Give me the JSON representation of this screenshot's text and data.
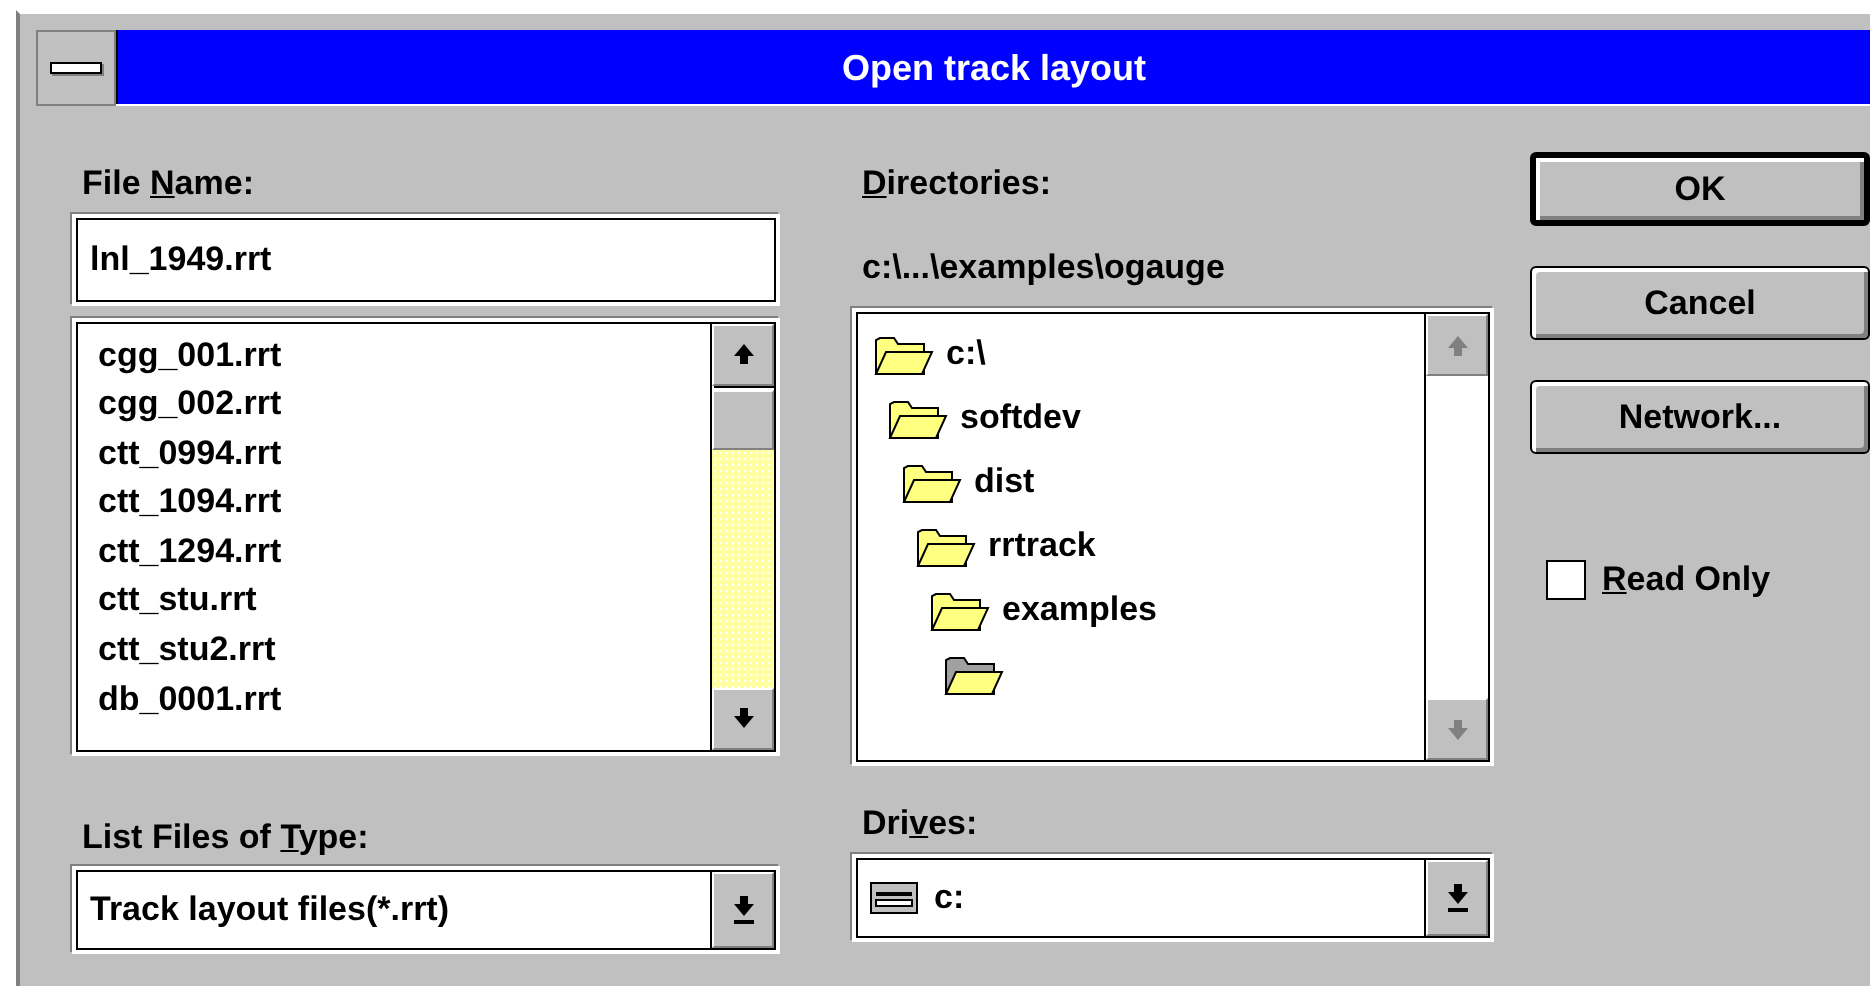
{
  "window": {
    "title": "Open track layout"
  },
  "file_name": {
    "label_start": "File ",
    "access_key": "N",
    "label_end": "ame:",
    "value": "lnl_1949.rrt"
  },
  "files": [
    "cgg_001.rrt",
    "cgg_002.rrt",
    "ctt_0994.rrt",
    "ctt_1094.rrt",
    "ctt_1294.rrt",
    "ctt_stu.rrt",
    "ctt_stu2.rrt",
    "db_0001.rrt"
  ],
  "file_type": {
    "label_start": "List Files of ",
    "access_key": "T",
    "label_end": "ype:",
    "value": "Track layout files(*.rrt)"
  },
  "directories": {
    "access_key": "D",
    "label_end": "irectories:",
    "path": "c:\\...\\examples\\ogauge",
    "tree": [
      {
        "name": "c:\\",
        "kind": "open",
        "children": [
          {
            "name": "softdev",
            "kind": "open",
            "children": [
              {
                "name": "dist",
                "kind": "open",
                "children": [
                  {
                    "name": "rrtrack",
                    "kind": "open",
                    "children": [
                      {
                        "name": "examples",
                        "kind": "open",
                        "children": [
                          {
                            "kind": "current"
                          }
                        ]
                      }
                    ]
                  }
                ]
              }
            ]
          }
        ]
      }
    ]
  },
  "drives": {
    "label_start": "Dri",
    "access_key": "v",
    "label_end": "es:",
    "value": "c:"
  },
  "buttons": [
    {
      "label": "OK",
      "default": true
    },
    {
      "label": "Cancel",
      "default": false
    },
    {
      "label": "Network...",
      "default": false
    }
  ],
  "read_only": {
    "access_key": "R",
    "label_end": "ead Only",
    "checked": false
  }
}
